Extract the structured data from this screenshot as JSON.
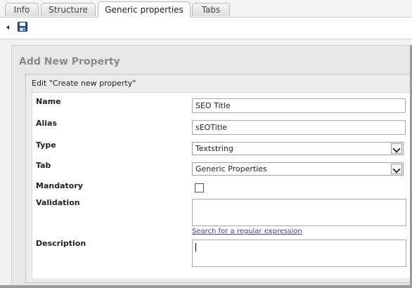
{
  "tabs": [
    {
      "label": "Info",
      "active": false
    },
    {
      "label": "Structure",
      "active": false
    },
    {
      "label": "Generic properties",
      "active": true
    },
    {
      "label": "Tabs",
      "active": false
    }
  ],
  "toolbar": {
    "back_icon": "left-arrow-icon",
    "save_icon": "floppy-disk-save-icon"
  },
  "page": {
    "title": "Add New Property",
    "legend": "Edit \"Create new property\""
  },
  "form": {
    "name": {
      "label": "Name",
      "value": "SEO Title"
    },
    "alias": {
      "label": "Alias",
      "value": "sEOTitle"
    },
    "type": {
      "label": "Type",
      "selected": "Textstring"
    },
    "tab": {
      "label": "Tab",
      "selected": "Generic Properties"
    },
    "mandatory": {
      "label": "Mandatory",
      "checked": false
    },
    "validation": {
      "label": "Validation",
      "value": "",
      "link": "Search for a regular expression"
    },
    "description": {
      "label": "Description",
      "value": ""
    }
  },
  "colors": {
    "link": "#1f4fa8",
    "title_gray": "#8a8a8a",
    "save_icon_blue": "#1b4f9c"
  }
}
